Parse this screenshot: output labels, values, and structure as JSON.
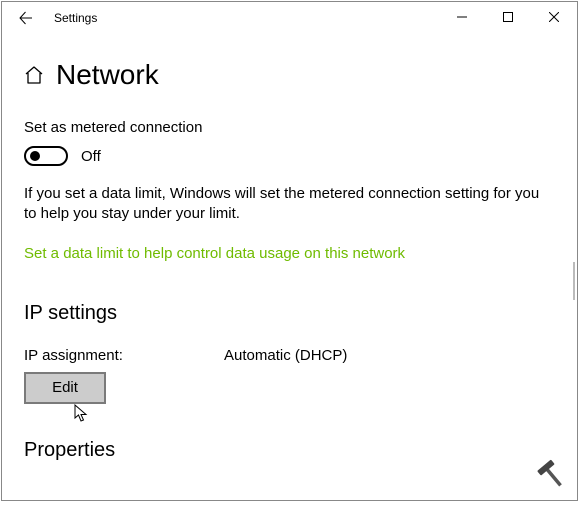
{
  "titlebar": {
    "title": "Settings"
  },
  "page": {
    "title": "Network"
  },
  "metered": {
    "label": "Set as metered connection",
    "state": "Off",
    "description": "If you set a data limit, Windows will set the metered connection setting for you to help you stay under your limit.",
    "link": "Set a data limit to help control data usage on this network"
  },
  "ip_settings": {
    "section_title": "IP settings",
    "assignment_label": "IP assignment:",
    "assignment_value": "Automatic (DHCP)",
    "edit_button": "Edit"
  },
  "properties": {
    "section_title": "Properties"
  }
}
